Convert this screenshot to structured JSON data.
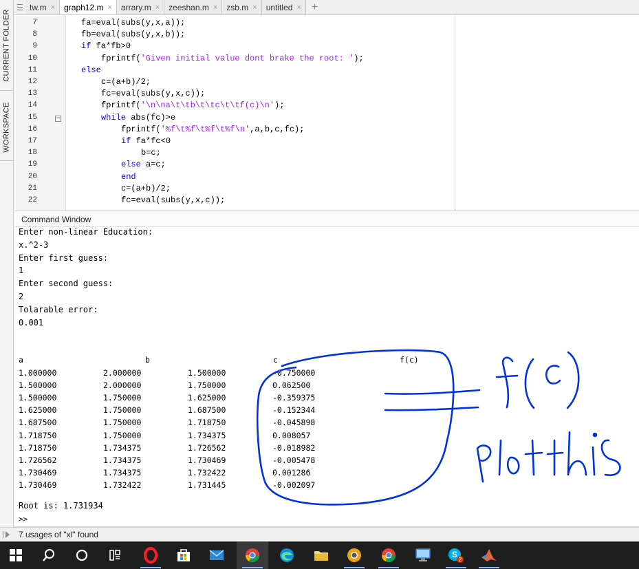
{
  "sidebar": {
    "current_folder_label": "CURRENT FOLDER",
    "workspace_label": "WORKSPACE"
  },
  "tabs": [
    {
      "label": "tw.m",
      "active": false
    },
    {
      "label": "graph12.m",
      "active": true
    },
    {
      "label": "arrary.m",
      "active": false
    },
    {
      "label": "zeeshan.m",
      "active": false
    },
    {
      "label": "zsb.m",
      "active": false
    },
    {
      "label": "untitled",
      "active": false
    }
  ],
  "tab_close_glyph": "×",
  "tab_add_glyph": "+",
  "editor": {
    "line_numbers": [
      "7",
      "8",
      "9",
      "10",
      "11",
      "12",
      "13",
      "14",
      "15",
      "16",
      "17",
      "18",
      "19",
      "20",
      "21",
      "22"
    ],
    "fold_glyph": "−"
  },
  "command_window": {
    "title": "Command Window",
    "lines": [
      "Enter non-linear Education:",
      "x.^2-3",
      "Enter first guess:",
      "1",
      "Enter second guess:",
      "2",
      "Tolarable error:",
      "0.001"
    ],
    "headers": [
      "a",
      "b",
      "c",
      "f(c)"
    ],
    "rows": [
      [
        "1.000000",
        "2.000000",
        "1.500000",
        "-0.750000"
      ],
      [
        "1.500000",
        "2.000000",
        "1.750000",
        "0.062500"
      ],
      [
        "1.500000",
        "1.750000",
        "1.625000",
        "-0.359375"
      ],
      [
        "1.625000",
        "1.750000",
        "1.687500",
        "-0.152344"
      ],
      [
        "1.687500",
        "1.750000",
        "1.718750",
        "-0.045898"
      ],
      [
        "1.718750",
        "1.750000",
        "1.734375",
        "0.008057"
      ],
      [
        "1.718750",
        "1.734375",
        "1.726562",
        "-0.018982"
      ],
      [
        "1.726562",
        "1.734375",
        "1.730469",
        "-0.005478"
      ],
      [
        "1.730469",
        "1.734375",
        "1.732422",
        "0.001286"
      ],
      [
        "1.730469",
        "1.732422",
        "1.731445",
        "-0.002097"
      ]
    ],
    "root_line": "Root is: 1.731934",
    "prompt": ">>"
  },
  "status": {
    "text": "7 usages of \"xl\" found"
  },
  "colors": {
    "keyword": "#0000ff",
    "string": "#a020f0",
    "ink": "#0033dd",
    "taskbar": "#1e1e1e"
  },
  "taskbar_icons": [
    "windows-start-icon",
    "search-icon",
    "cortana-icon",
    "task-view-icon",
    "opera-icon",
    "store-icon",
    "mail-icon",
    "chrome-icon",
    "edge-icon",
    "file-explorer-icon",
    "chrome-dev-icon",
    "chrome-icon",
    "remote-desktop-icon",
    "skype-icon",
    "matlab-icon"
  ],
  "annotations": {
    "note_label": "f(c)",
    "note_text": "plot this"
  }
}
